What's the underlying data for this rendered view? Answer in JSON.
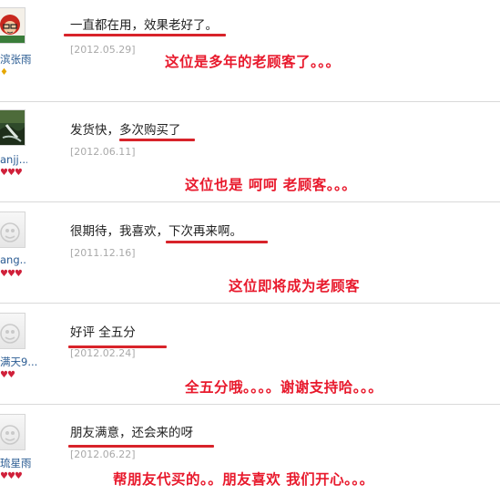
{
  "reviews": [
    {
      "user": "滨张雨",
      "badge": "♦",
      "comment": "一直都在用，效果老好了。",
      "date": "[2012.05.29]",
      "annotation": "这位是多年的老顾客了。。。"
    },
    {
      "user": "anjj...",
      "badge": "♥♥♥",
      "comment": "发货快，多次购买了",
      "date": "[2012.06.11]",
      "annotation": "这位也是 呵呵 老顾客。。。"
    },
    {
      "user": "ang...",
      "badge": "♥♥♥",
      "comment": "很期待，我喜欢，下次再来啊。",
      "date": "[2011.12.16]",
      "annotation": "这位即将成为老顾客"
    },
    {
      "user": "满天9...",
      "badge": "♥♥",
      "comment": "好评 全五分",
      "date": "[2012.02.24]",
      "annotation": "全五分哦。。。。谢谢支持哈。。。"
    },
    {
      "user": "琉星雨",
      "badge": "♥♥♥",
      "comment": "朋友满意，还会来的呀",
      "date": "[2012.06.22]",
      "annotation": "帮朋友代买的。。朋友喜欢 我们开心。。。"
    }
  ],
  "colors": {
    "annotation": "#e8192c",
    "underline": "#d8232a",
    "username": "#2b5c93",
    "date": "#a9a9a9"
  }
}
